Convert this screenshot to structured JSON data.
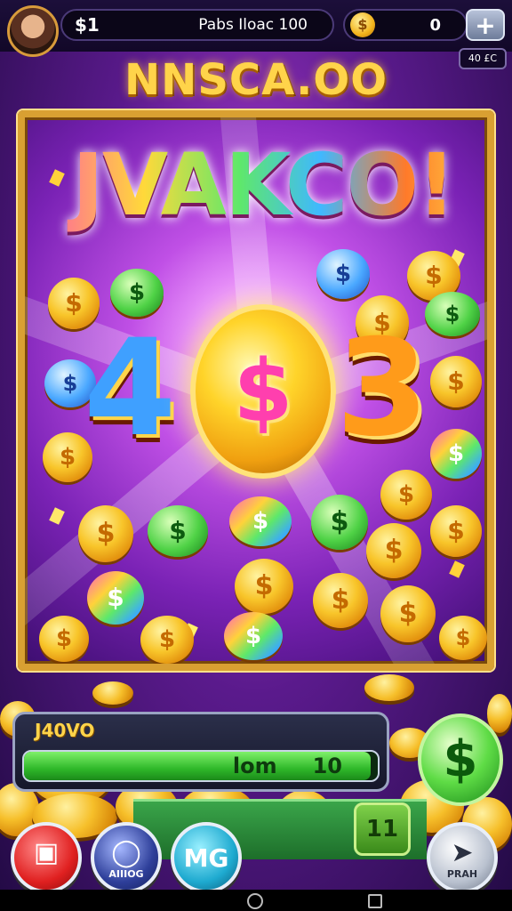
{
  "top_bar": {
    "currency_symbol": "$1",
    "title": "Pabs Iloac 100",
    "coin_glyph": "$",
    "coin_count": "0",
    "plus_label": "+",
    "badge": "40 £C"
  },
  "headline": "NNSCA.OO",
  "stage": {
    "jackpot_text": "JVAKCO!",
    "digit_left": "4",
    "coin_symbol": "$",
    "digit_right": "3",
    "coin_glyph": "$"
  },
  "progress": {
    "label": "J40VO",
    "left_text": "lom",
    "right_text": "10",
    "fraction": 0.98
  },
  "side_button": {
    "glyph": "$"
  },
  "bet": {
    "value": "11"
  },
  "buttons": [
    {
      "icon": "▣",
      "label": ""
    },
    {
      "icon": "◯",
      "label": "AIIIOG"
    },
    {
      "icon": "MG",
      "label": ""
    },
    {
      "icon": "➤",
      "label": "PRAH"
    }
  ],
  "colors": {
    "gold": "#ffd44a",
    "accent_purple": "#c050e6",
    "progress_green": "#2fb82a"
  }
}
